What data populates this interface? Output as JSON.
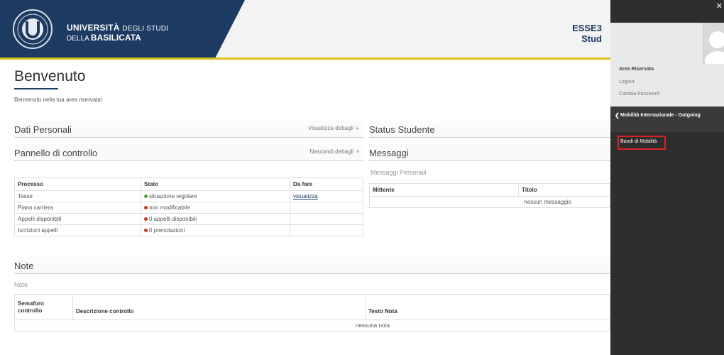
{
  "header": {
    "uni_line1_bold": "UNIVERSITÀ",
    "uni_line1_thin": "DEGLI STUDI",
    "uni_line2_thin": "DELLA",
    "uni_line2_bold": "BASILICATA",
    "right_line1": "ESSE3",
    "right_line2": "Stud"
  },
  "page": {
    "title": "Benvenuto",
    "welcome": "Benvenuto nella tua area riservata!"
  },
  "sections": {
    "dati_personali": {
      "title": "Dati Personali",
      "link": "Visualizza dettagli"
    },
    "pannello": {
      "title": "Pannello di controllo",
      "link": "Nascondi dettagli"
    },
    "status": {
      "title": "Status Studente"
    },
    "messaggi": {
      "title": "Messaggi",
      "sub": "Messaggi Personali"
    },
    "note": {
      "title": "Note",
      "sub": "Note"
    }
  },
  "process_table": {
    "headers": [
      "Processo",
      "Stato",
      "Da fare"
    ],
    "rows": [
      {
        "processo": "Tasse",
        "stato": "situazione regolare",
        "status": "green",
        "da_fare": "visualizza"
      },
      {
        "processo": "Piano carriera",
        "stato": "non modificabile",
        "status": "red",
        "da_fare": ""
      },
      {
        "processo": "Appelli disponibili",
        "stato": "0 appelli disponibili",
        "status": "red",
        "da_fare": ""
      },
      {
        "processo": "Iscrizioni appelli",
        "stato": "0 prenotazioni",
        "status": "red",
        "da_fare": ""
      }
    ]
  },
  "messages_table": {
    "headers": [
      "Mittente",
      "Titolo"
    ],
    "empty": "nessun messaggio"
  },
  "note_table": {
    "headers": [
      "Semaforo controllo",
      "Descrizione controllo",
      "Testo Nota"
    ],
    "empty": "nessuna nota"
  },
  "sidebar": {
    "close": "✕",
    "area_title": "Area Riservata",
    "logout": "Logout",
    "change_password": "Cambia Password",
    "menu_head": "Mobilità Internazionale - Outgoing",
    "item": "Bandi di Mobilità"
  },
  "colors": {
    "brand": "#1d3a63",
    "accent": "#d8c21a",
    "ok": "#4caa2c",
    "ko": "#c8361e",
    "highlight": "#d92323"
  }
}
